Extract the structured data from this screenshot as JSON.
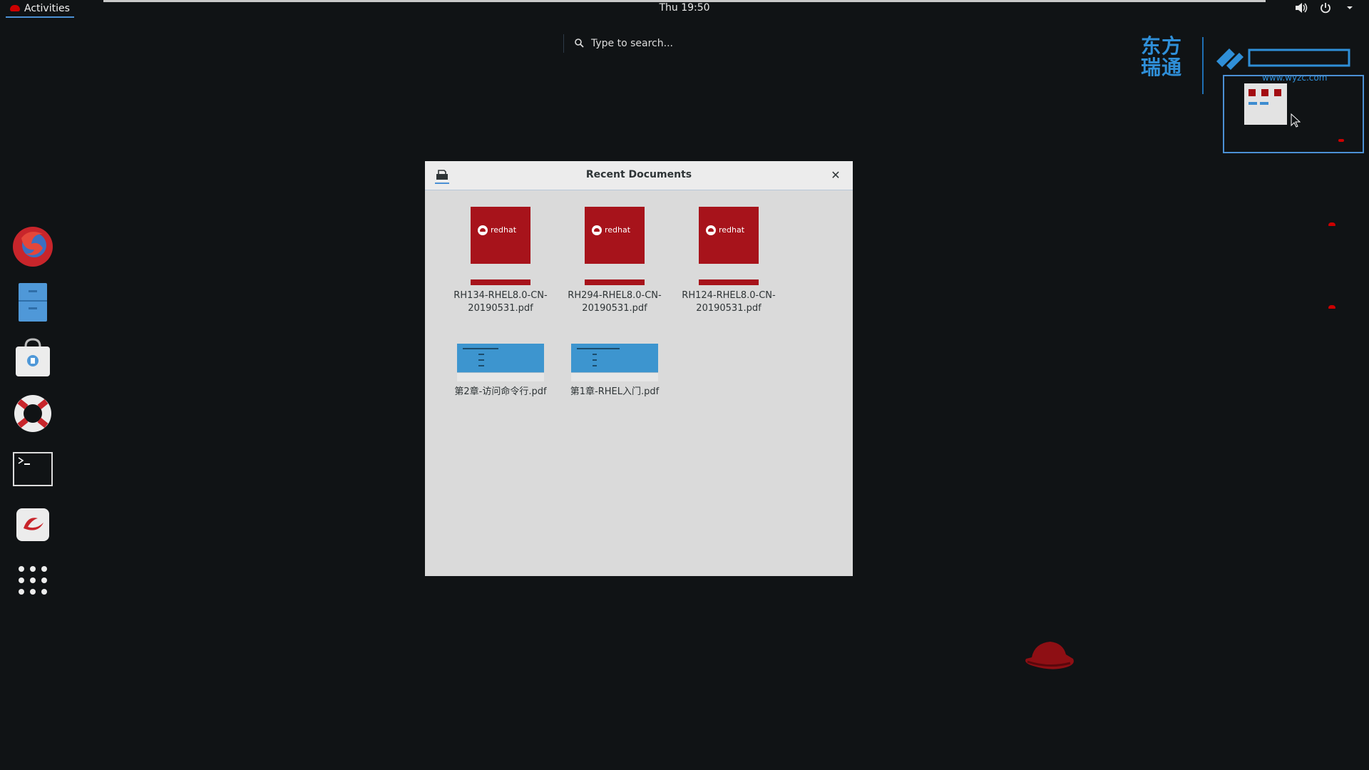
{
  "topbar": {
    "activities_label": "Activities",
    "clock": "Thu 19:50",
    "icons": [
      "volume-icon",
      "power-icon",
      "chevron-down-icon"
    ]
  },
  "search": {
    "placeholder": "Type to search..."
  },
  "dash": {
    "items": [
      {
        "name": "firefox-launcher",
        "icon": "firefox-icon"
      },
      {
        "name": "files-launcher",
        "icon": "file-manager-icon"
      },
      {
        "name": "software-launcher",
        "icon": "software-store-icon"
      },
      {
        "name": "help-launcher",
        "icon": "lifebuoy-icon"
      },
      {
        "name": "terminal-launcher",
        "icon": "terminal-icon"
      },
      {
        "name": "redhat-customer-portal-launcher",
        "icon": "redhat-icon"
      },
      {
        "name": "show-applications",
        "icon": "app-grid-icon"
      }
    ]
  },
  "branding": {
    "line1": "东方",
    "line2": "瑞通",
    "url": "www.wyzc.com"
  },
  "dialog": {
    "title": "Recent Documents",
    "documents": [
      {
        "name": "RH134-RHEL8.0-CN-20190531.pdf",
        "thumb": "redhat",
        "thumb_text": "redhat"
      },
      {
        "name": "RH294-RHEL8.0-CN-20190531.pdf",
        "thumb": "redhat",
        "thumb_text": "redhat"
      },
      {
        "name": "RH124-RHEL8.0-CN-20190531.pdf",
        "thumb": "redhat",
        "thumb_text": "redhat"
      },
      {
        "name": "第2章-访问命令行.pdf",
        "thumb": "blue"
      },
      {
        "name": "第1章-RHEL入门.pdf",
        "thumb": "blue"
      }
    ]
  },
  "colors": {
    "background": "#101315",
    "accent": "#4b90d4",
    "redhat": "#a7131b",
    "dialog_bg": "#dadada"
  }
}
